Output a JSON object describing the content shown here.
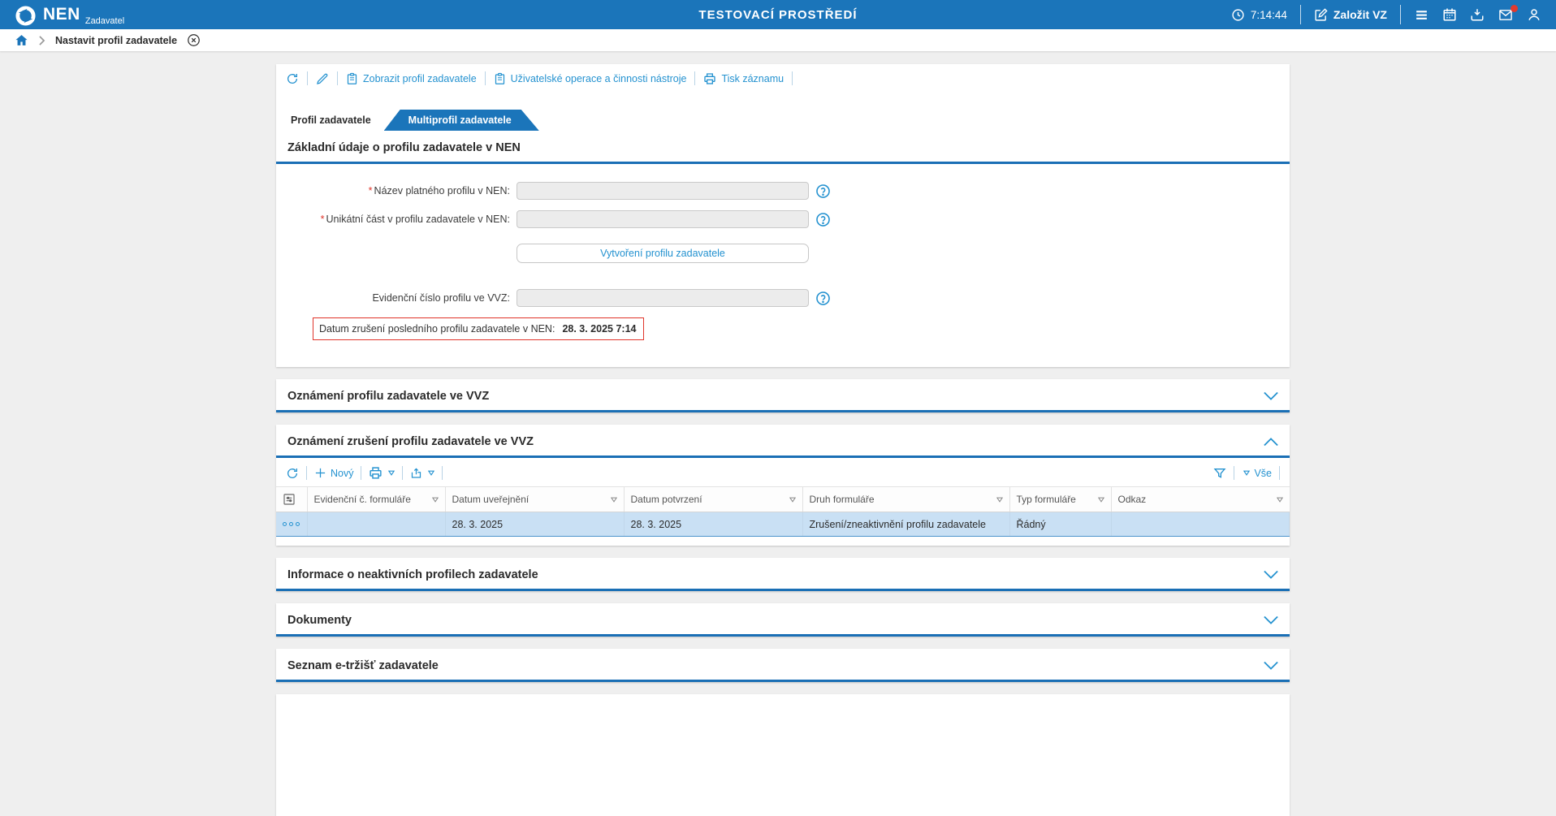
{
  "colors": {
    "topbar_bg": "#1b75ba",
    "accent_link": "#2492d0",
    "section_underline": "#1a6fb5",
    "alert_red": "#e0352b",
    "selected_row_bg": "#c9e0f4"
  },
  "topbar": {
    "logo_text": "NEN",
    "logo_subtitle": "Zadavatel",
    "env_title": "TESTOVACÍ PROSTŘEDÍ",
    "time": "7:14:44",
    "new_tender_label": "Založit VZ"
  },
  "breadcrumb": {
    "item": "Nastavit profil zadavatele"
  },
  "record_toolbar": {
    "view_profile": "Zobrazit profil zadavatele",
    "user_operations": "Uživatelské operace a činnosti nástroje",
    "print_record": "Tisk záznamu"
  },
  "tabs": {
    "active": "Profil zadavatele",
    "inactive": "Multiprofil zadavatele"
  },
  "basic_section": {
    "title": "Základní údaje o profilu zadavatele v NEN",
    "required_mark": "*",
    "fields": {
      "nazev": {
        "label": "Název platného profilu v NEN:",
        "value": ""
      },
      "unikatni": {
        "label": "Unikátní část v profilu zadavatele v NEN:",
        "value": ""
      },
      "evidencni": {
        "label": "Evidenční číslo profilu ve VVZ:",
        "value": ""
      }
    },
    "create_button": "Vytvoření profilu zadavatele",
    "cancel_date_label": "Datum zrušení posledního profilu zadavatele v NEN:",
    "cancel_date_value": "28. 3. 2025 7:14"
  },
  "sections": {
    "vvz_notice": "Oznámení profilu zadavatele ve VVZ",
    "vvz_cancel_notice": "Oznámení zrušení profilu zadavatele ve VVZ",
    "inactive_profiles": "Informace o neaktivních profilech zadavatele",
    "documents": "Dokumenty",
    "emarkets": "Seznam e-tržišť zadavatele"
  },
  "grid": {
    "new_label": "Nový",
    "filter_all_label": "Vše",
    "columns": [
      "Evidenční č. formuláře",
      "Datum uveřejnění",
      "Datum potvrzení",
      "Druh formuláře",
      "Typ formuláře",
      "Odkaz"
    ],
    "row": {
      "evidencni_c_formulare": "",
      "datum_uverejneni": "28. 3. 2025",
      "datum_potvrzeni": "28. 3. 2025",
      "druh_formulare": "Zrušení/zneaktivnění profilu zadavatele",
      "typ_formulare": "Řádný",
      "odkaz": ""
    }
  }
}
